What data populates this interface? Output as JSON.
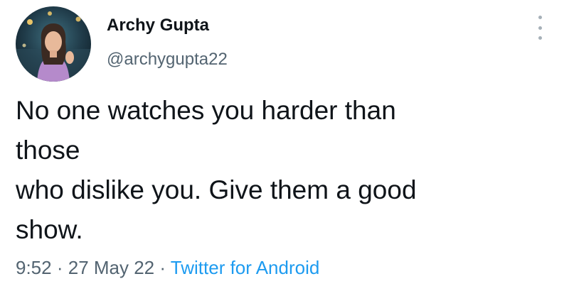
{
  "author": {
    "name": "Archy Gupta",
    "handle": "@archygupta22"
  },
  "tweet": {
    "lines": [
      "No one watches you harder than",
      "those",
      "who dislike you. Give them a good",
      "show."
    ]
  },
  "meta": {
    "time": "9:52",
    "separator": "·",
    "date": "27 May 22",
    "source": "Twitter for Android"
  },
  "icons": {
    "more": "more-vertical-icon",
    "avatar": "avatar"
  },
  "colors": {
    "text": "#0f1419",
    "secondary": "#536471",
    "link": "#1d9bf0"
  }
}
